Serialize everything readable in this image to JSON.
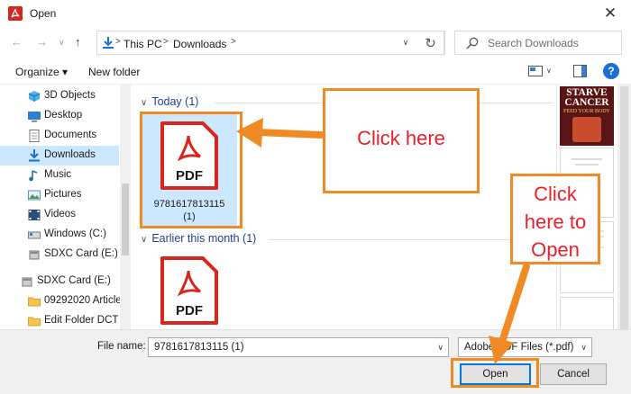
{
  "window": {
    "title": "Open",
    "close_glyph": "✕"
  },
  "nav": {
    "back_glyph": "←",
    "forward_glyph": "→",
    "recent_glyph": "∨",
    "up_glyph": "↑",
    "breadcrumb": [
      "This PC",
      "Downloads"
    ],
    "chevron_glyph": ">",
    "dropdown_glyph": "∨",
    "refresh_glyph": "↻"
  },
  "search": {
    "placeholder": "Search Downloads"
  },
  "toolbar": {
    "organize_label": "Organize ▾",
    "new_folder_label": "New folder",
    "help_label": "?"
  },
  "sidebar": {
    "items": [
      {
        "label": "3D Objects",
        "icon": "3d-objects-icon",
        "selected": false
      },
      {
        "label": "Desktop",
        "icon": "desktop-icon",
        "selected": false
      },
      {
        "label": "Documents",
        "icon": "documents-icon",
        "selected": false
      },
      {
        "label": "Downloads",
        "icon": "downloads-icon",
        "selected": true
      },
      {
        "label": "Music",
        "icon": "music-icon",
        "selected": false
      },
      {
        "label": "Pictures",
        "icon": "pictures-icon",
        "selected": false
      },
      {
        "label": "Videos",
        "icon": "videos-icon",
        "selected": false
      },
      {
        "label": "Windows (C:)",
        "icon": "drive-icon",
        "selected": false
      },
      {
        "label": "SDXC Card (E:)",
        "icon": "sd-card-icon",
        "selected": false
      },
      {
        "label": "SDXC Card (E:)",
        "icon": "sd-card-icon",
        "selected": false
      },
      {
        "label": "09292020 Article",
        "icon": "folder-icon",
        "selected": false
      },
      {
        "label": "Edit Folder DCT",
        "icon": "folder-icon",
        "selected": false
      }
    ]
  },
  "content": {
    "groups": [
      {
        "header": "Today (1)",
        "chevron": "∨",
        "files": [
          {
            "name_line1": "9781617813115",
            "name_line2": "(1)",
            "icon_label": "PDF",
            "selected": true
          }
        ]
      },
      {
        "header": "Earlier this month (1)",
        "chevron": "∨",
        "files": [
          {
            "name_line1": "",
            "name_line2": "",
            "icon_label": "PDF",
            "selected": false
          }
        ]
      }
    ]
  },
  "preview": {
    "title": "STARVE CANCER",
    "subtitle": "FEED YOUR BODY"
  },
  "footer": {
    "file_name_label": "File name:",
    "file_name_value": "9781617813115 (1)",
    "file_type_value": "Adobe PDF Files (*.pdf)",
    "open_label": "Open",
    "cancel_label": "Cancel"
  },
  "annotations": {
    "callout_file": "Click here",
    "callout_open_line1": "Click",
    "callout_open_line2": "here to",
    "callout_open_line3": "Open",
    "accent_color": "#f08a24",
    "text_color": "#e8202a"
  }
}
